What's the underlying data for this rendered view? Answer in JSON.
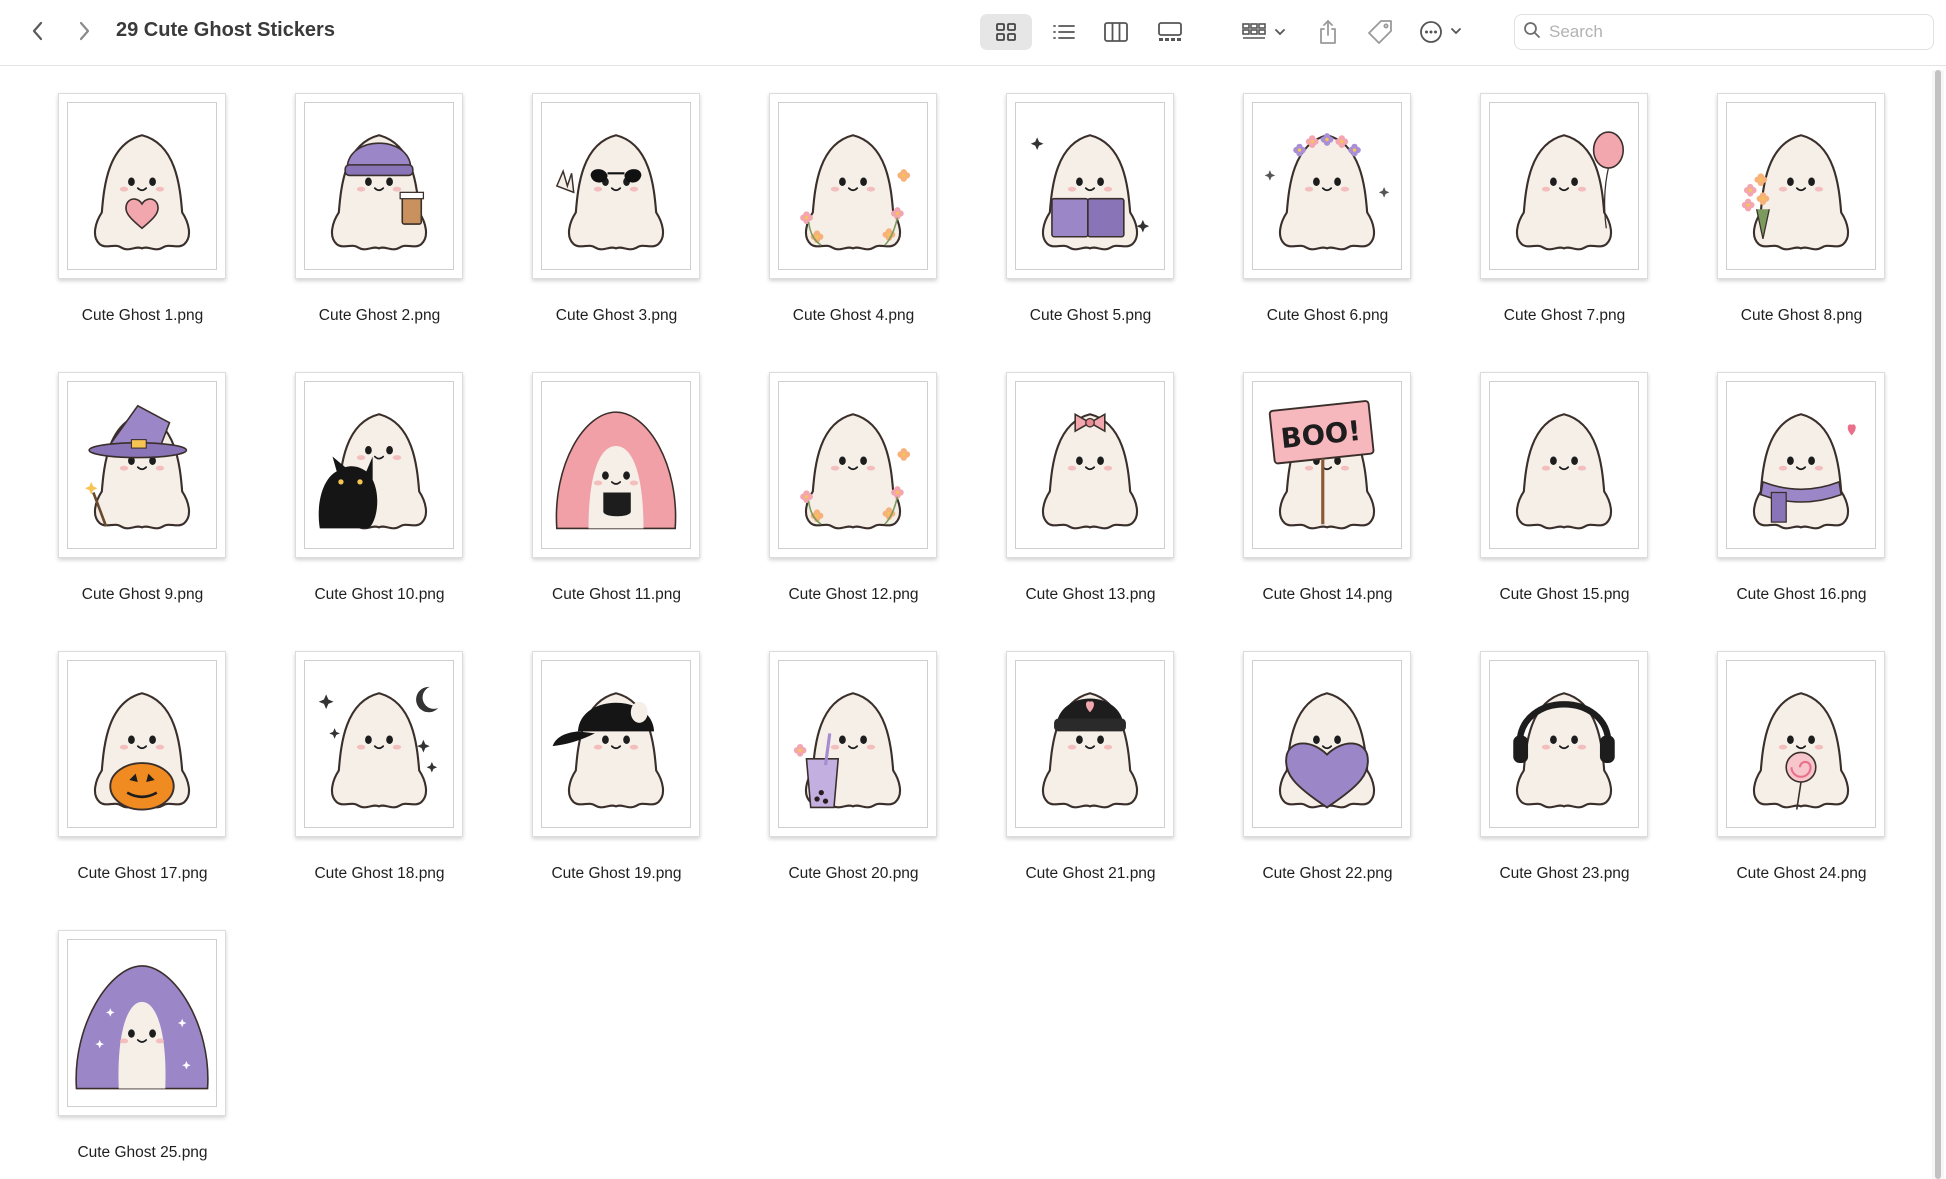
{
  "window": {
    "title": "29 Cute Ghost Stickers"
  },
  "toolbar": {
    "search_placeholder": "Search",
    "icons": [
      "chevron-left-icon",
      "chevron-right-icon",
      "icon-view-icon",
      "list-view-icon",
      "column-view-icon",
      "gallery-view-icon",
      "group-icon",
      "share-icon",
      "tag-icon",
      "more-icon",
      "search-icon"
    ]
  },
  "colors": {
    "ghost": "#f6efe8",
    "outline": "#3a2f2b",
    "blush": "#f3b3b3",
    "purple": "#9b86c8",
    "pink": "#f2a6ad"
  },
  "files": [
    {
      "name": "Cute Ghost 1.png",
      "accessory": "heart"
    },
    {
      "name": "Cute Ghost 2.png",
      "accessory": "beanie-coffee"
    },
    {
      "name": "Cute Ghost 3.png",
      "accessory": "sunglasses"
    },
    {
      "name": "Cute Ghost 4.png",
      "accessory": "flowers"
    },
    {
      "name": "Cute Ghost 5.png",
      "accessory": "book"
    },
    {
      "name": "Cute Ghost 6.png",
      "accessory": "flower-crown"
    },
    {
      "name": "Cute Ghost 7.png",
      "accessory": "balloon"
    },
    {
      "name": "Cute Ghost 8.png",
      "accessory": "bouquet"
    },
    {
      "name": "Cute Ghost 9.png",
      "accessory": "witch-hat"
    },
    {
      "name": "Cute Ghost 10.png",
      "accessory": "black-cat"
    },
    {
      "name": "Cute Ghost 11.png",
      "accessory": "pink-blanket"
    },
    {
      "name": "Cute Ghost 12.png",
      "accessory": "flowers"
    },
    {
      "name": "Cute Ghost 13.png",
      "accessory": "bow"
    },
    {
      "name": "Cute Ghost 14.png",
      "accessory": "boo-sign",
      "sign_text": "BOO!"
    },
    {
      "name": "Cute Ghost 15.png",
      "accessory": "none"
    },
    {
      "name": "Cute Ghost 16.png",
      "accessory": "scarf"
    },
    {
      "name": "Cute Ghost 17.png",
      "accessory": "pumpkin"
    },
    {
      "name": "Cute Ghost 18.png",
      "accessory": "stars-moon"
    },
    {
      "name": "Cute Ghost 19.png",
      "accessory": "cap"
    },
    {
      "name": "Cute Ghost 20.png",
      "accessory": "boba"
    },
    {
      "name": "Cute Ghost 21.png",
      "accessory": "black-beanie"
    },
    {
      "name": "Cute Ghost 22.png",
      "accessory": "purple-heart"
    },
    {
      "name": "Cute Ghost 23.png",
      "accessory": "headphones"
    },
    {
      "name": "Cute Ghost 24.png",
      "accessory": "lollipop"
    },
    {
      "name": "Cute Ghost 25.png",
      "accessory": "star-blanket"
    }
  ]
}
